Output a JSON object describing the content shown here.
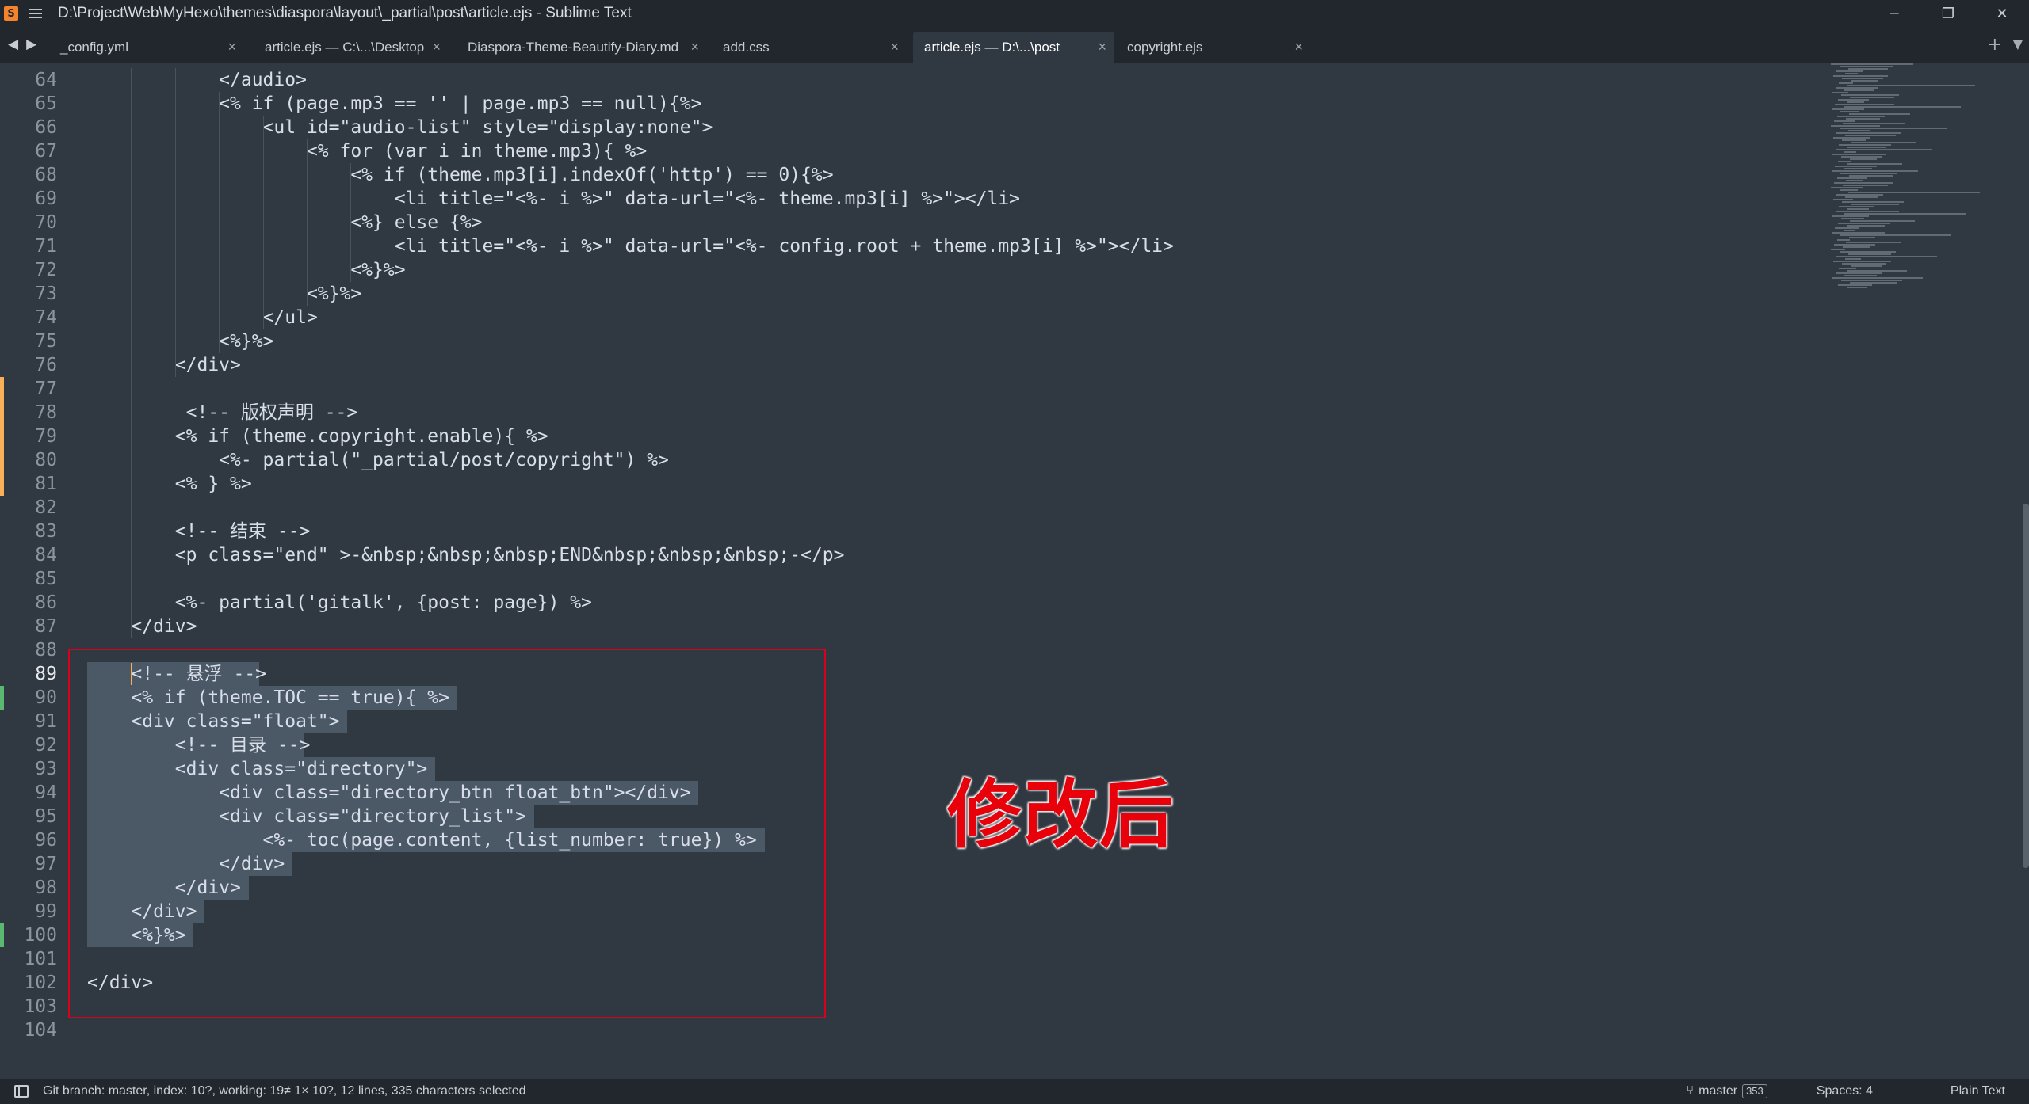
{
  "window": {
    "app_icon": "sublime-text-icon",
    "title": "D:\\Project\\Web\\MyHexo\\themes\\diaspora\\layout\\_partial\\post\\article.ejs - Sublime Text",
    "minimize": "─",
    "maximize": "❐",
    "close": "✕"
  },
  "tabs": [
    {
      "label": "_config.yml",
      "active": false
    },
    {
      "label": "article.ejs — C:\\...\\Desktop",
      "active": false
    },
    {
      "label": "Diaspora-Theme-Beautify-Diary.md",
      "active": false
    },
    {
      "label": "add.css",
      "active": false
    },
    {
      "label": "article.ejs — D:\\...\\post",
      "active": true
    },
    {
      "label": "copyright.ejs",
      "active": false
    }
  ],
  "tab_close": "×",
  "tab_nav": {
    "back": "◀",
    "forward": "▶"
  },
  "tab_add": "+",
  "tab_dropdown": "▼",
  "editor": {
    "current_line": "89",
    "colors": {
      "modified_marker": "#f9ae58",
      "added_marker": "#5bb870",
      "selection": "#4b5866"
    },
    "lines": [
      {
        "n": "64",
        "text": "            </audio>"
      },
      {
        "n": "65",
        "text": "            <% if (page.mp3 == '' | page.mp3 == null){%>"
      },
      {
        "n": "66",
        "text": "                <ul id=\"audio-list\" style=\"display:none\">"
      },
      {
        "n": "67",
        "text": "                    <% for (var i in theme.mp3){ %>"
      },
      {
        "n": "68",
        "text": "                        <% if (theme.mp3[i].indexOf('http') == 0){%>"
      },
      {
        "n": "69",
        "text": "                            <li title=\"<%- i %>\" data-url=\"<%- theme.mp3[i] %>\"></li>"
      },
      {
        "n": "70",
        "text": "                        <%} else {%>"
      },
      {
        "n": "71",
        "text": "                            <li title=\"<%- i %>\" data-url=\"<%- config.root + theme.mp3[i] %>\"></li>"
      },
      {
        "n": "72",
        "text": "                        <%}%>"
      },
      {
        "n": "73",
        "text": "                    <%}%>"
      },
      {
        "n": "74",
        "text": "                </ul>"
      },
      {
        "n": "75",
        "text": "            <%}%>"
      },
      {
        "n": "76",
        "text": "        </div>"
      },
      {
        "n": "77",
        "text": ""
      },
      {
        "n": "78",
        "text": "         <!-- 版权声明 -->"
      },
      {
        "n": "79",
        "text": "        <% if (theme.copyright.enable){ %>"
      },
      {
        "n": "80",
        "text": "            <%- partial(\"_partial/post/copyright\") %>"
      },
      {
        "n": "81",
        "text": "        <% } %>"
      },
      {
        "n": "82",
        "text": ""
      },
      {
        "n": "83",
        "text": "        <!-- 结束 -->"
      },
      {
        "n": "84",
        "text": "        <p class=\"end\" >-&nbsp;&nbsp;&nbsp;END&nbsp;&nbsp;&nbsp;-</p>"
      },
      {
        "n": "85",
        "text": ""
      },
      {
        "n": "86",
        "text": "        <%- partial('gitalk', {post: page}) %>"
      },
      {
        "n": "87",
        "text": "    </div>"
      },
      {
        "n": "88",
        "text": ""
      },
      {
        "n": "89",
        "text": "    <!-- 悬浮 -->"
      },
      {
        "n": "90",
        "text": "    <% if (theme.TOC == true){ %>"
      },
      {
        "n": "91",
        "text": "    <div class=\"float\">"
      },
      {
        "n": "92",
        "text": "        <!-- 目录 -->"
      },
      {
        "n": "93",
        "text": "        <div class=\"directory\">"
      },
      {
        "n": "94",
        "text": "            <div class=\"directory_btn float_btn\"></div>"
      },
      {
        "n": "95",
        "text": "            <div class=\"directory_list\">"
      },
      {
        "n": "96",
        "text": "                <%- toc(page.content, {list_number: true}) %>"
      },
      {
        "n": "97",
        "text": "            </div>"
      },
      {
        "n": "98",
        "text": "        </div>"
      },
      {
        "n": "99",
        "text": "    </div>"
      },
      {
        "n": "100",
        "text": "    <%}%>"
      },
      {
        "n": "101",
        "text": ""
      },
      {
        "n": "102",
        "text": "</div>"
      },
      {
        "n": "103",
        "text": ""
      },
      {
        "n": "104",
        "text": ""
      }
    ]
  },
  "annotation": {
    "text": "修改后",
    "color": "#e8000b"
  },
  "status_bar": {
    "panel_icon": "panel-toggle-icon",
    "git_info": "Git branch: master, index: 10?, working: 19≠ 1× 10?, 12 lines, 335 characters selected",
    "branch_icon": "git-branch-icon",
    "branch": "master",
    "branch_badge": "353",
    "spaces": "Spaces: 4",
    "syntax": "Plain Text"
  }
}
